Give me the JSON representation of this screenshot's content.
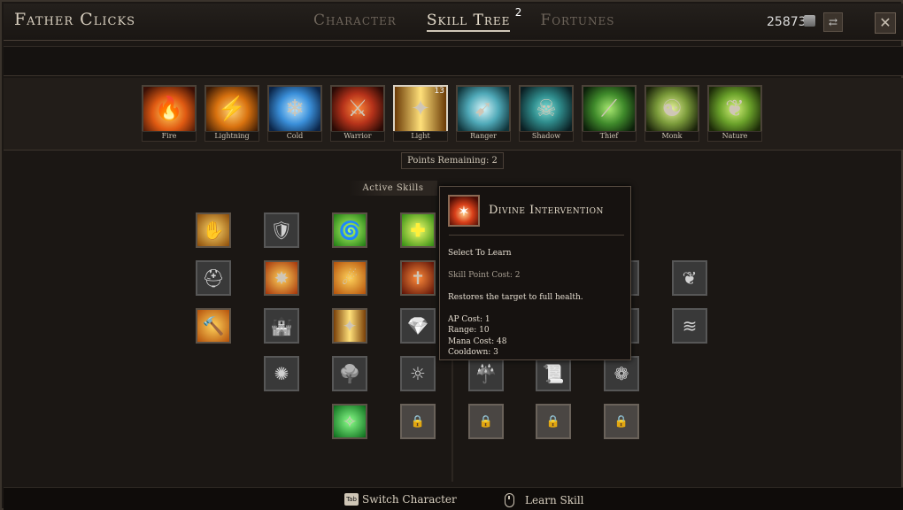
{
  "header": {
    "title": "Father Clicks",
    "tabs": [
      {
        "label": "Character"
      },
      {
        "label": "Skill Tree",
        "badge": "2"
      },
      {
        "label": "Fortunes"
      }
    ],
    "active_tab": "Skill Tree",
    "gold_amount": "25873"
  },
  "skill_trees": [
    {
      "label": "Fire",
      "icon": "fire-figure-icon",
      "color": "#e05a12"
    },
    {
      "label": "Lightning",
      "icon": "lightning-hammer-icon",
      "color": "#d9720f"
    },
    {
      "label": "Cold",
      "icon": "ice-crystal-icon",
      "color": "#3a8fd9"
    },
    {
      "label": "Warrior",
      "icon": "warrior-icon",
      "color": "#b5321a"
    },
    {
      "label": "Light",
      "icon": "light-beam-icon",
      "color": "#f2b61a",
      "level": "13",
      "selected": true
    },
    {
      "label": "Ranger",
      "icon": "arrow-icon",
      "color": "#4fa9b8"
    },
    {
      "label": "Shadow",
      "icon": "shadow-mask-icon",
      "color": "#2f8c8c"
    },
    {
      "label": "Thief",
      "icon": "claw-icon",
      "color": "#3f8a2b"
    },
    {
      "label": "Monk",
      "icon": "monk-icon",
      "color": "#7a9a3a"
    },
    {
      "label": "Nature",
      "icon": "nature-icon",
      "color": "#6aa12a"
    }
  ],
  "points_remaining": "Points Remaining: 2",
  "active_skills_label": "Active Skills",
  "tooltip": {
    "title": "Divine Intervention",
    "prompt": "Select To Learn",
    "cost": "Skill Point Cost: 2",
    "description": "Restores the target to full health.",
    "ap_cost": "AP Cost: 1",
    "range": "Range: 10",
    "mana_cost": "Mana Cost: 48",
    "cooldown": "Cooldown: 3"
  },
  "footer": {
    "switch_key": "Tab",
    "switch_label": "Switch Character",
    "learn_label": "Learn Skill"
  }
}
